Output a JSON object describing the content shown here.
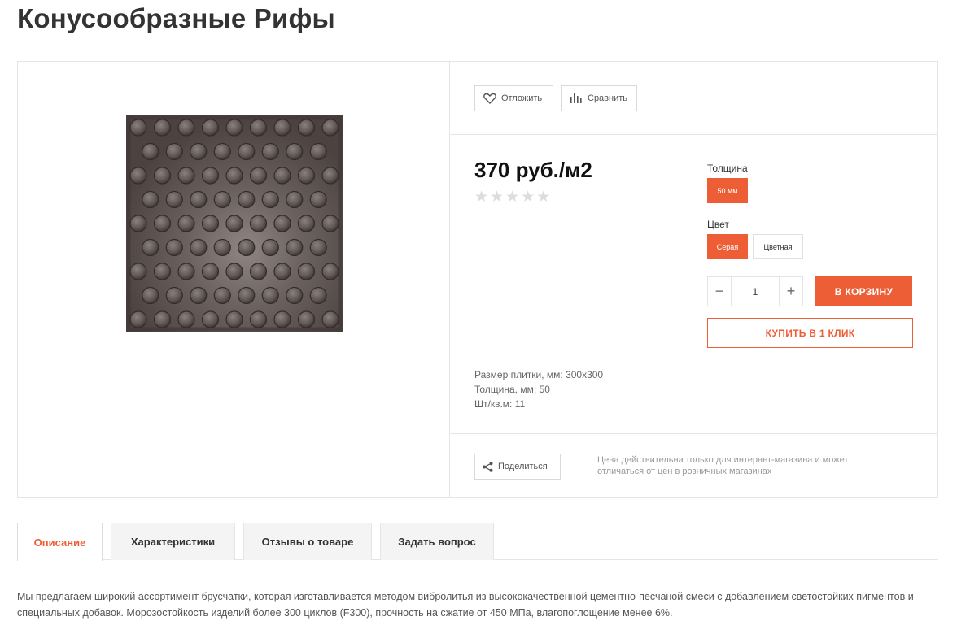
{
  "page": {
    "title": "Конусообразные Рифы"
  },
  "actions": {
    "defer_label": "Отложить",
    "compare_label": "Сравнить"
  },
  "price": {
    "value": "370 руб./м2",
    "rating_stars": 0,
    "rating_max": 5
  },
  "options": {
    "thickness": {
      "label": "Толщина",
      "values": [
        "50 мм"
      ],
      "selected": "50 мм"
    },
    "color": {
      "label": "Цвет",
      "values": [
        "Серая",
        "Цветная"
      ],
      "selected": "Серая"
    }
  },
  "quantity": {
    "value": "1",
    "minus": "−",
    "plus": "+"
  },
  "buttons": {
    "add_to_cart": "В КОРЗИНУ",
    "buy_one_click": "КУПИТЬ В 1 КЛИК"
  },
  "properties": [
    "Размер плитки, мм: 300x300",
    "Толщина, мм: 50",
    "Шт/кв.м: 11"
  ],
  "share": {
    "label": "Поделиться"
  },
  "price_note": "Цена действительна только для интернет-магазина и может отличаться от цен в розничных магазинах",
  "tabs": [
    {
      "label": "Описание",
      "active": true
    },
    {
      "label": "Характеристики",
      "active": false
    },
    {
      "label": "Отзывы о товаре",
      "active": false
    },
    {
      "label": "Задать вопрос",
      "active": false
    }
  ],
  "description": "Мы предлагаем широкий ассортимент брусчатки, которая изготавливается методом вибролитья из высококачественной цементно-песчаной смеси с добавлением светостойких пигментов и специальных добавок. Морозостойкость изделий более 300 циклов (F300), прочность на сжатие от 450 МПа, влагопоглощение менее 6%.",
  "colors": {
    "accent": "#ee5e36",
    "border": "#e5e5e5",
    "tile": "#5e5452"
  },
  "icons": {
    "defer": "heart-icon",
    "compare": "bar-chart-icon",
    "share": "share-icon",
    "rating": "star-icon"
  }
}
